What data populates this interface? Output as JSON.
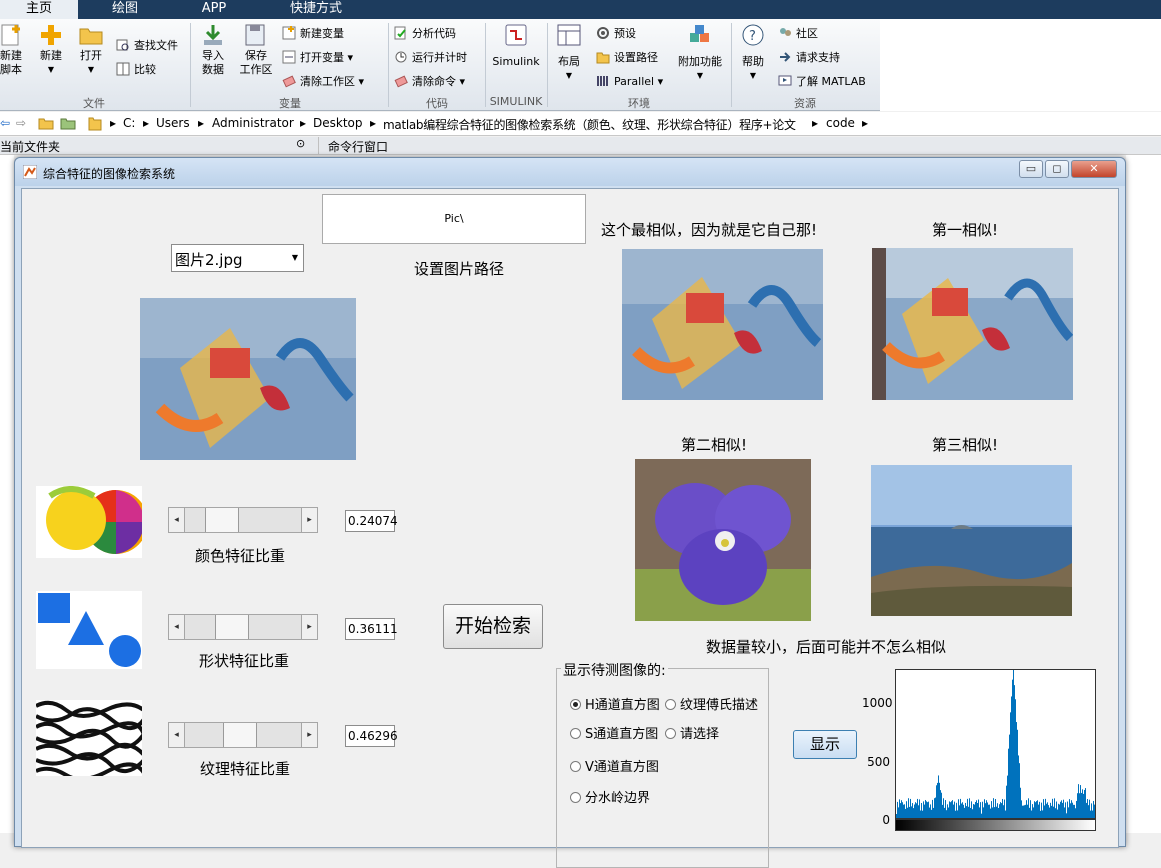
{
  "ribbon": {
    "tabs": [
      "主页",
      "绘图",
      "APP",
      "快捷方式"
    ],
    "active_tab": "主页",
    "groups": [
      "文件",
      "变量",
      "代码",
      "SIMULINK",
      "环境",
      "资源"
    ],
    "file": {
      "new_script": "新建\n脚本",
      "new": "新建",
      "open": "打开",
      "find_files": "查找文件",
      "compare": "比较"
    },
    "variable": {
      "import": "导入\n数据",
      "save": "保存\n工作区",
      "new_var": "新建变量",
      "open_var": "打开变量",
      "clear_ws": "清除工作区"
    },
    "code": {
      "analyze": "分析代码",
      "run_time": "运行并计时",
      "clear_cmd": "清除命令"
    },
    "simulink": {
      "simulink": "Simulink"
    },
    "env": {
      "layout": "布局",
      "prefs": "预设",
      "set_path": "设置路径",
      "parallel": "Parallel",
      "addons": "附加功能"
    },
    "resources": {
      "help": "帮助",
      "community": "社区",
      "support": "请求支持",
      "learn": "了解 MATLAB"
    }
  },
  "address": {
    "crumbs": [
      "C:",
      "Users",
      "Administrator",
      "Desktop",
      "matlab编程综合特征的图像检索系统（颜色、纹理、形状综合特征）程序+论文",
      "code"
    ]
  },
  "panes": {
    "current_folder": "当前文件夹",
    "command_window": "命令行窗口"
  },
  "window": {
    "title": "综合特征的图像检索系统"
  },
  "gui": {
    "path_box": "Pic\\",
    "set_path_label": "设置图片路径",
    "image_select": "图片2.jpg",
    "color": {
      "label": "颜色特征比重",
      "value": "0.24074",
      "fraction": 0.24
    },
    "shape": {
      "label": "形状特征比重",
      "value": "0.36111",
      "fraction": 0.36
    },
    "texture": {
      "label": "纹理特征比重",
      "value": "0.46296",
      "fraction": 0.46
    },
    "search_button": "开始检索",
    "most_similar": "这个最相似，因为就是它自己那!",
    "first": "第一相似!",
    "second": "第二相似!",
    "third": "第三相似!",
    "note": "数据量较小，后面可能并不怎么相似",
    "display_group": "显示待测图像的:",
    "radios": [
      "H通道直方图",
      "纹理傅氏描述",
      "S通道直方图",
      "请选择",
      "V通道直方图",
      "分水岭边界"
    ],
    "selected_radio": "H通道直方图",
    "show_button": "显示",
    "hist_y_ticks": [
      "1000",
      "500",
      "0"
    ],
    "hist_color": "#0072bd"
  }
}
